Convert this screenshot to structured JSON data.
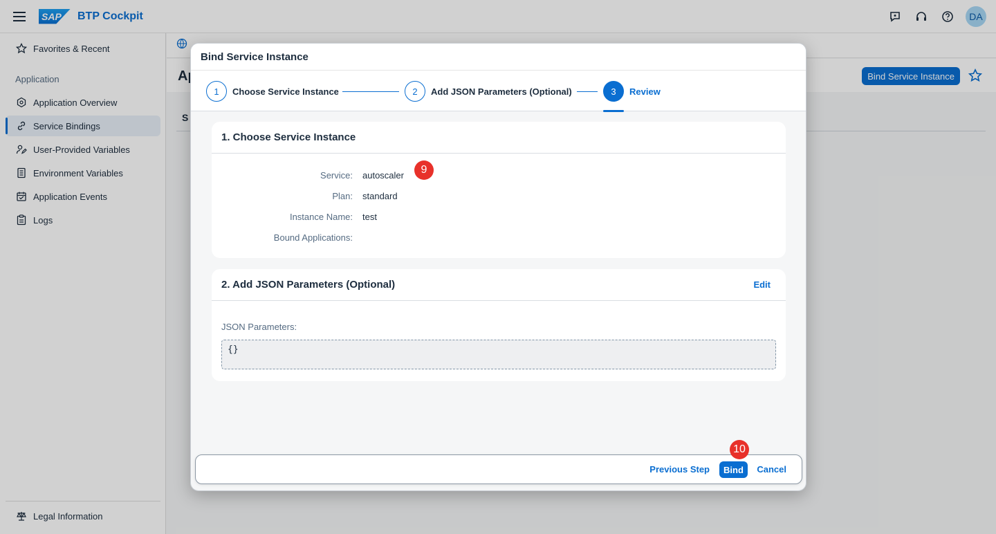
{
  "shell": {
    "title": "BTP Cockpit",
    "logo_text": "SAP",
    "avatar": "DA"
  },
  "sidebar": {
    "favorites": "Favorites & Recent",
    "group": "Application",
    "items": [
      {
        "label": "Application Overview",
        "icon": "hexagon-icon"
      },
      {
        "label": "Service Bindings",
        "icon": "link-icon",
        "active": true
      },
      {
        "label": "User-Provided Variables",
        "icon": "user-edit-icon"
      },
      {
        "label": "Environment Variables",
        "icon": "document-list-icon"
      },
      {
        "label": "Application Events",
        "icon": "calendar-icon"
      },
      {
        "label": "Logs",
        "icon": "clipboard-icon"
      }
    ],
    "legal": "Legal Information"
  },
  "page": {
    "title_fragment": "Ap",
    "sub_fragment": "S",
    "bind_button": "Bind Service Instance"
  },
  "dialog": {
    "title": "Bind Service Instance",
    "steps": [
      {
        "num": "1",
        "label": "Choose Service Instance"
      },
      {
        "num": "2",
        "label": "Add JSON Parameters (Optional)"
      },
      {
        "num": "3",
        "label": "Review"
      }
    ],
    "section1": {
      "title": "1. Choose Service Instance",
      "rows": [
        {
          "label": "Service:",
          "value": "autoscaler"
        },
        {
          "label": "Plan:",
          "value": "standard"
        },
        {
          "label": "Instance Name:",
          "value": "test"
        },
        {
          "label": "Bound Applications:",
          "value": ""
        }
      ]
    },
    "section2": {
      "title": "2. Add JSON Parameters (Optional)",
      "edit": "Edit",
      "json_label": "JSON Parameters:",
      "json_value": "{}"
    },
    "footer": {
      "previous": "Previous Step",
      "bind": "Bind",
      "cancel": "Cancel"
    }
  },
  "annotations": {
    "badge1": "9",
    "badge2": "10"
  },
  "colors": {
    "accent": "#0a6ed1",
    "badge": "#e8312a"
  }
}
